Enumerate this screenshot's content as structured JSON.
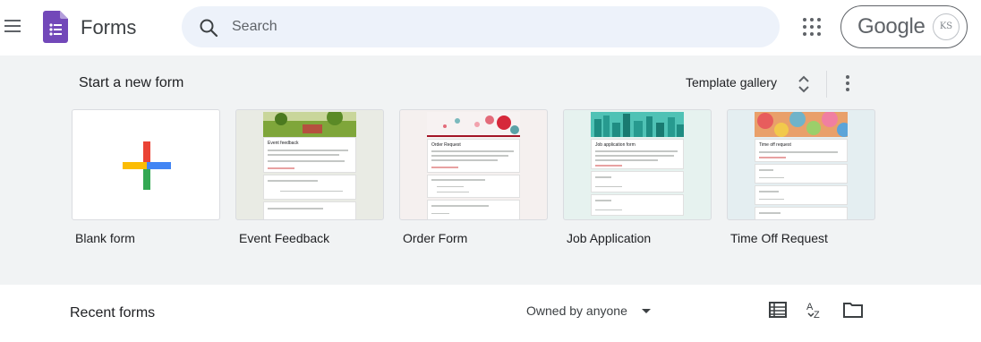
{
  "header": {
    "app_title": "Forms",
    "search_placeholder": "Search",
    "account_brand": "Google",
    "avatar_initials": "KS",
    "brand_color": "#7248b9"
  },
  "templates_section": {
    "title": "Start a new form",
    "gallery_label": "Template gallery",
    "templates": [
      {
        "label": "Blank form",
        "thumbnail": "plus-icon"
      },
      {
        "label": "Event Feedback",
        "thumbnail": "event-feedback-preview",
        "mini_title": "Event feedback"
      },
      {
        "label": "Order Form",
        "thumbnail": "order-form-preview",
        "mini_title": "Order Request"
      },
      {
        "label": "Job Application",
        "thumbnail": "job-application-preview",
        "mini_title": "Job application form"
      },
      {
        "label": "Time Off Request",
        "thumbnail": "time-off-preview",
        "mini_title": "Time off request"
      }
    ]
  },
  "recent_section": {
    "title": "Recent forms",
    "owner_filter": "Owned by anyone",
    "icons": [
      "list-view-icon",
      "sort-az-icon",
      "folder-icon"
    ]
  }
}
